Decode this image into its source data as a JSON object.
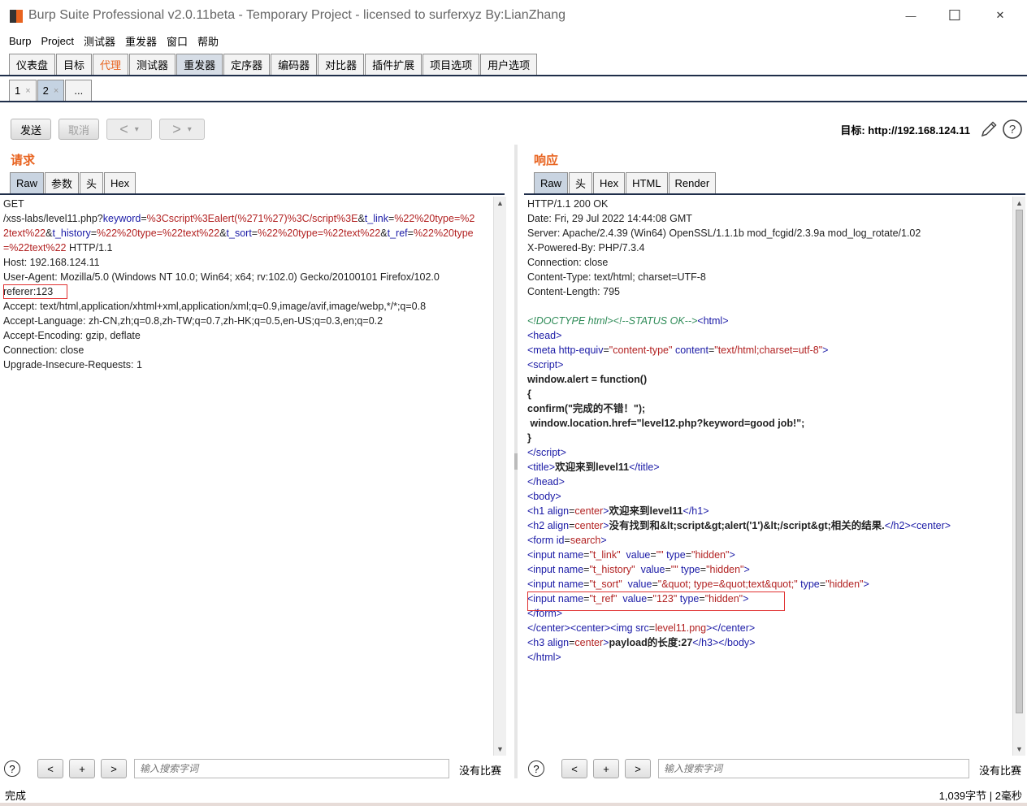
{
  "window": {
    "title": "Burp Suite Professional v2.0.11beta - Temporary Project - licensed to surferxyz By:LianZhang",
    "controls": {
      "minimize": "—",
      "maximize": "☐",
      "close": "✕"
    }
  },
  "menu": [
    "Burp",
    "Project",
    "测试器",
    "重发器",
    "窗口",
    "帮助"
  ],
  "main_tabs": [
    "仪表盘",
    "目标",
    "代理",
    "测试器",
    "重发器",
    "定序器",
    "编码器",
    "对比器",
    "插件扩展",
    "项目选项",
    "用户选项"
  ],
  "active_main_tab": "重发器",
  "sub_tabs": [
    {
      "label": "1",
      "close": "×"
    },
    {
      "label": "2",
      "close": "×"
    },
    {
      "label": "..."
    }
  ],
  "toolbar": {
    "send": "发送",
    "cancel": "取消",
    "back": "<",
    "forward": ">",
    "dropdown": "▾",
    "target_label": "目标: http://192.168.124.11"
  },
  "request": {
    "title": "请求",
    "tabs": [
      "Raw",
      "参数",
      "头",
      "Hex"
    ],
    "method": "GET",
    "url_path": "/xss-labs/level11.php?",
    "params": [
      {
        "k": "keyword",
        "v": "%3Cscript%3Ealert(%271%27)%3C/script%3E"
      },
      {
        "k": "t_link",
        "v": "%22%20type=%22text%22"
      },
      {
        "k": "t_history",
        "v": "%22%20type=%22text%22"
      },
      {
        "k": "t_sort",
        "v": "%22%20type=%22text%22"
      },
      {
        "k": "t_ref",
        "v": "%22%20type=%22text%22"
      }
    ],
    "protocol": " HTTP/1.1",
    "headers": [
      "Host: 192.168.124.11",
      "User-Agent: Mozilla/5.0 (Windows NT 10.0; Win64; x64; rv:102.0) Gecko/20100101 Firefox/102.0",
      "referer:123",
      "Accept: text/html,application/xhtml+xml,application/xml;q=0.9,image/avif,image/webp,*/*;q=0.8",
      "Accept-Language: zh-CN,zh;q=0.8,zh-TW;q=0.7,zh-HK;q=0.5,en-US;q=0.3,en;q=0.2",
      "Accept-Encoding: gzip, deflate",
      "Connection: close",
      "Upgrade-Insecure-Requests: 1"
    ]
  },
  "response": {
    "title": "响应",
    "tabs": [
      "Raw",
      "头",
      "Hex",
      "HTML",
      "Render"
    ],
    "headers": [
      "HTTP/1.1 200 OK",
      "Date: Fri, 29 Jul 2022 14:44:08 GMT",
      "Server: Apache/2.4.39 (Win64) OpenSSL/1.1.1b mod_fcgid/2.3.9a mod_log_rotate/1.02",
      "X-Powered-By: PHP/7.3.4",
      "Connection: close",
      "Content-Type: text/html; charset=UTF-8",
      "Content-Length: 795"
    ],
    "body": {
      "doctype": "<!DOCTYPE html><!--STATUS OK-->",
      "script_lines": [
        "window.alert = function()",
        "{",
        "confirm(\"完成的不错！\");",
        " window.location.href=\"level12.php?keyword=good job!\";",
        "}"
      ],
      "title_text": "欢迎来到level11",
      "h1_text": "欢迎来到level11",
      "h2_text": "没有找到和&lt;script&gt;alert('1')&lt;/script&gt;相关的结果.",
      "form_id": "search",
      "inputs": [
        {
          "name": "t_link",
          "value": ""
        },
        {
          "name": "t_history",
          "value": ""
        },
        {
          "name": "t_sort",
          "value": "&quot; type=&quot;text&quot;"
        },
        {
          "name": "t_ref",
          "value": "123"
        }
      ],
      "img_src": "level11.png",
      "h3_text": "payload的长度:27"
    }
  },
  "search_bar": {
    "help": "?",
    "prev": "<",
    "add": "+",
    "next": ">",
    "placeholder": "输入搜索字词",
    "no_match": "没有比赛"
  },
  "status": {
    "left": "完成",
    "right": "1,039字节 | 2毫秒"
  }
}
